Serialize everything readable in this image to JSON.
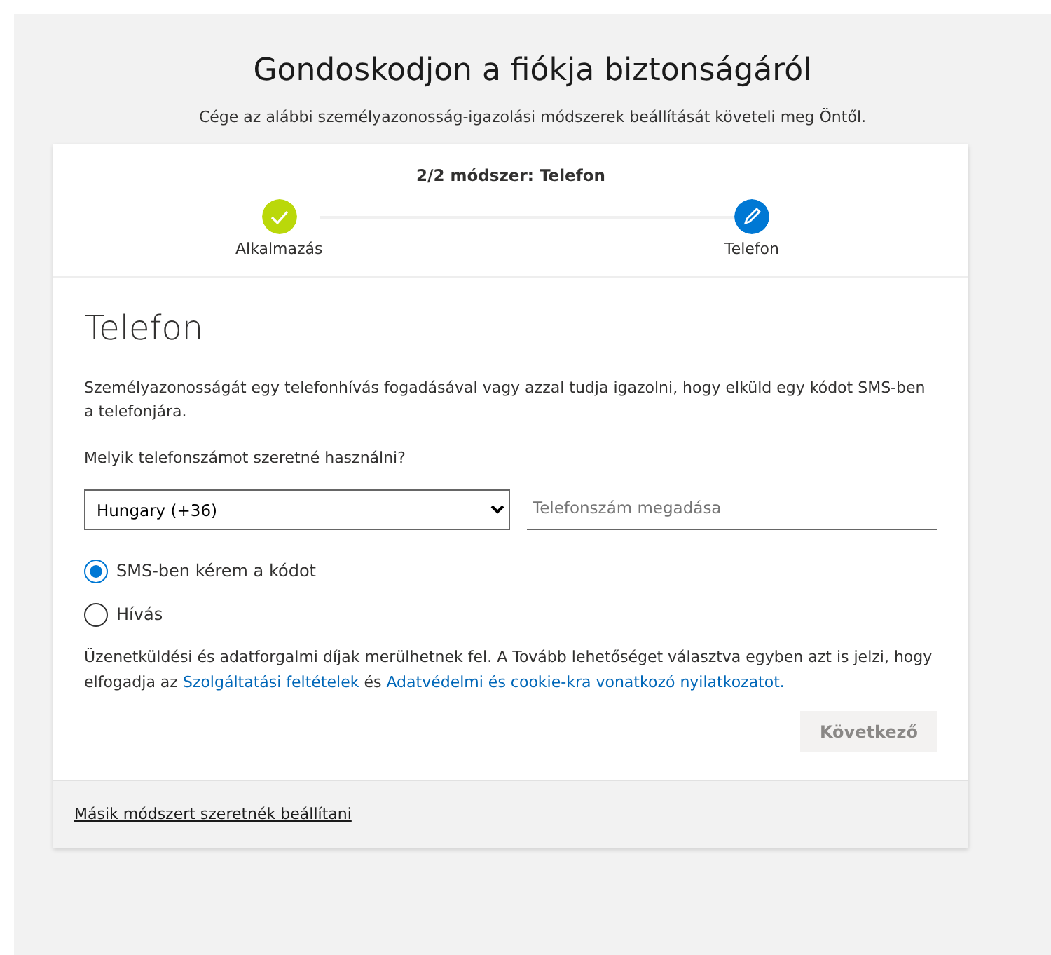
{
  "page_title": "Gondoskodjon a fiókja biztonságáról",
  "subtitle": "Cége az alábbi személyazonosság-igazolási módszerek beállítását követeli meg Öntől.",
  "progress": {
    "label": "2/2 módszer: Telefon",
    "steps": [
      {
        "label": "Alkalmazás",
        "completed": true
      },
      {
        "label": "Telefon",
        "completed": false
      }
    ]
  },
  "section_title": "Telefon",
  "description": "Személyazonosságát egy telefonhívás fogadásával vagy azzal tudja igazolni, hogy elküld egy kódot SMS-ben a telefonjára.",
  "question": "Melyik telefonszámot szeretné használni?",
  "country_select": {
    "value": "Hungary (+36)"
  },
  "phone_field": {
    "placeholder": "Telefonszám megadása"
  },
  "options": [
    {
      "label": "SMS-ben kérem a kódot",
      "selected": true
    },
    {
      "label": "Hívás",
      "selected": false
    }
  ],
  "notice": [
    {
      "kind": "text",
      "text": "Üzenetküldési és adatforgalmi díjak merülhetnek fel. A Tovább lehetőséget választva egyben azt is jelzi, hogy elfogadja az "
    },
    {
      "kind": "link",
      "text": "Szolgáltatási feltételek"
    },
    {
      "kind": "text",
      "text": " és "
    },
    {
      "kind": "link",
      "text": "Adatvédelmi és cookie-kra vonatkozó nyilatkozatot."
    }
  ],
  "next_button": {
    "label": "Következő",
    "disabled": true
  },
  "footer_link": "Másik módszert szeretnék beállítani"
}
